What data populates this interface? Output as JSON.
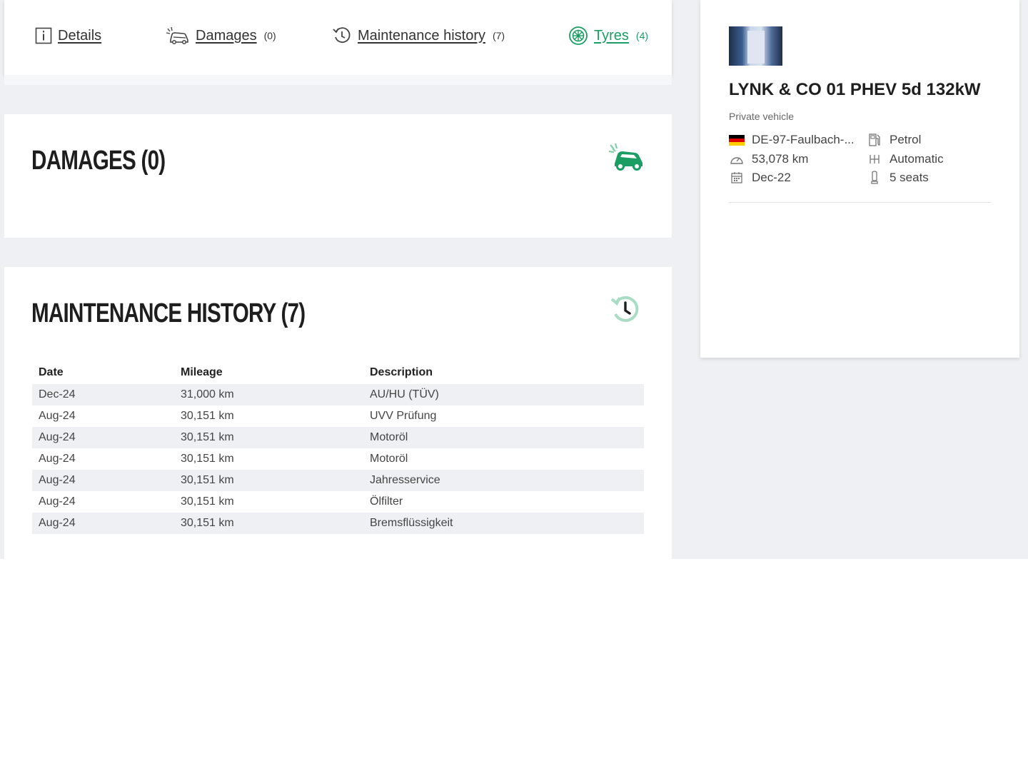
{
  "tabs": [
    {
      "label": "Details",
      "count": "",
      "icon": "info-icon"
    },
    {
      "label": "Damages",
      "count": "(0)",
      "icon": "damaged-car-icon"
    },
    {
      "label": "Maintenance history",
      "count": "(7)",
      "icon": "history-icon"
    },
    {
      "label": "Tyres",
      "count": "(4)",
      "icon": "tyre-icon",
      "active": true
    }
  ],
  "damages": {
    "title": "DAMAGES (0)",
    "icon": "damaged-car-icon"
  },
  "maintenance": {
    "title": "MAINTENANCE HISTORY (7)",
    "icon": "history-icon",
    "columns": [
      "Date",
      "Mileage",
      "Description"
    ],
    "rows": [
      [
        "Dec-24",
        "31,000 km",
        "AU/HU (TÜV)"
      ],
      [
        "Aug-24",
        "30,151 km",
        "UVV Prüfung"
      ],
      [
        "Aug-24",
        "30,151 km",
        "Motoröl"
      ],
      [
        "Aug-24",
        "30,151 km",
        "Motoröl"
      ],
      [
        "Aug-24",
        "30,151 km",
        "Jahresservice"
      ],
      [
        "Aug-24",
        "30,151 km",
        "Ölfilter"
      ],
      [
        "Aug-24",
        "30,151 km",
        "Bremsflüssigkeit"
      ]
    ]
  },
  "vehicle": {
    "title": "LYNK & CO 01 PHEV 5d 132kW",
    "subtitle": "Private vehicle",
    "location": "DE-97-Faulbach-...",
    "fuel": "Petrol",
    "mileage": "53,078 km",
    "transmission": "Automatic",
    "registration": "Dec-22",
    "seats": "5 seats"
  },
  "colors": {
    "accent": "#1a9e63",
    "accent_light": "#a8dcc3",
    "page_bg": "#eef0f3"
  }
}
